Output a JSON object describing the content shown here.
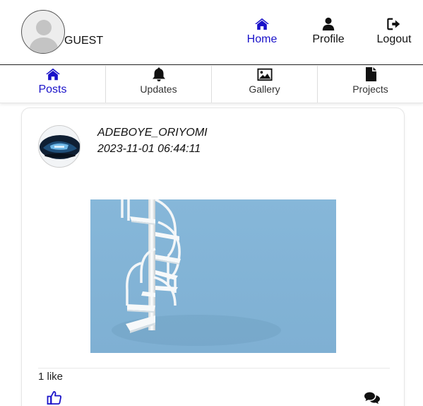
{
  "header": {
    "user_label": "GUEST",
    "nav": [
      {
        "label": "Home",
        "icon": "home-icon",
        "active": true
      },
      {
        "label": "Profile",
        "icon": "user-icon",
        "active": false
      },
      {
        "label": "Logout",
        "icon": "logout-icon",
        "active": false
      }
    ]
  },
  "tabs": [
    {
      "label": "Posts",
      "icon": "home-icon",
      "active": true
    },
    {
      "label": "Updates",
      "icon": "bell-icon",
      "active": false
    },
    {
      "label": "Gallery",
      "icon": "image-icon",
      "active": false
    },
    {
      "label": "Projects",
      "icon": "file-icon",
      "active": false
    }
  ],
  "post": {
    "author": "ADEBOYE_ORIYOMI",
    "timestamp": "2023-11-01 06:44:11",
    "likes_text": "1 like"
  },
  "colors": {
    "accent": "#1a12c9",
    "image_bg": "#82b3d6"
  }
}
